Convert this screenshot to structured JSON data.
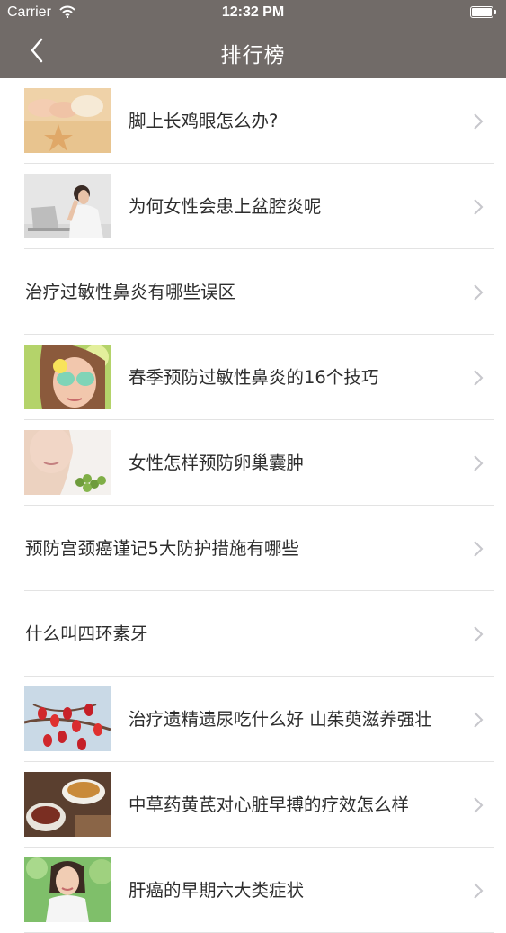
{
  "status_bar": {
    "carrier": "Carrier",
    "time": "12:32 PM"
  },
  "nav": {
    "title": "排行榜"
  },
  "items": [
    {
      "title": "脚上长鸡眼怎么办?",
      "thumbnail": "feet-on-sand"
    },
    {
      "title": "为何女性会患上盆腔炎呢",
      "thumbnail": "woman-with-laptop"
    },
    {
      "title": "治疗过敏性鼻炎有哪些误区",
      "thumbnail": null
    },
    {
      "title": "春季预防过敏性鼻炎的16个技巧",
      "thumbnail": "woman-with-flower-glasses"
    },
    {
      "title": "女性怎样预防卵巢囊肿",
      "thumbnail": "woman-with-grapes"
    },
    {
      "title": "预防宫颈癌谨记5大防护措施有哪些",
      "thumbnail": null
    },
    {
      "title": "什么叫四环素牙",
      "thumbnail": null
    },
    {
      "title": "治疗遗精遗尿吃什么好 山茱萸滋养强壮",
      "thumbnail": "red-berries-branch"
    },
    {
      "title": "中草药黄芪对心脏早搏的疗效怎么样",
      "thumbnail": "herbal-tea"
    },
    {
      "title": "肝癌的早期六大类症状",
      "thumbnail": "woman-smiling-outdoors"
    }
  ],
  "colors": {
    "header_bg": "#716b68",
    "text": "#2d2d2d",
    "separator": "#e3e3e3",
    "chevron": "#c7c7cc"
  }
}
